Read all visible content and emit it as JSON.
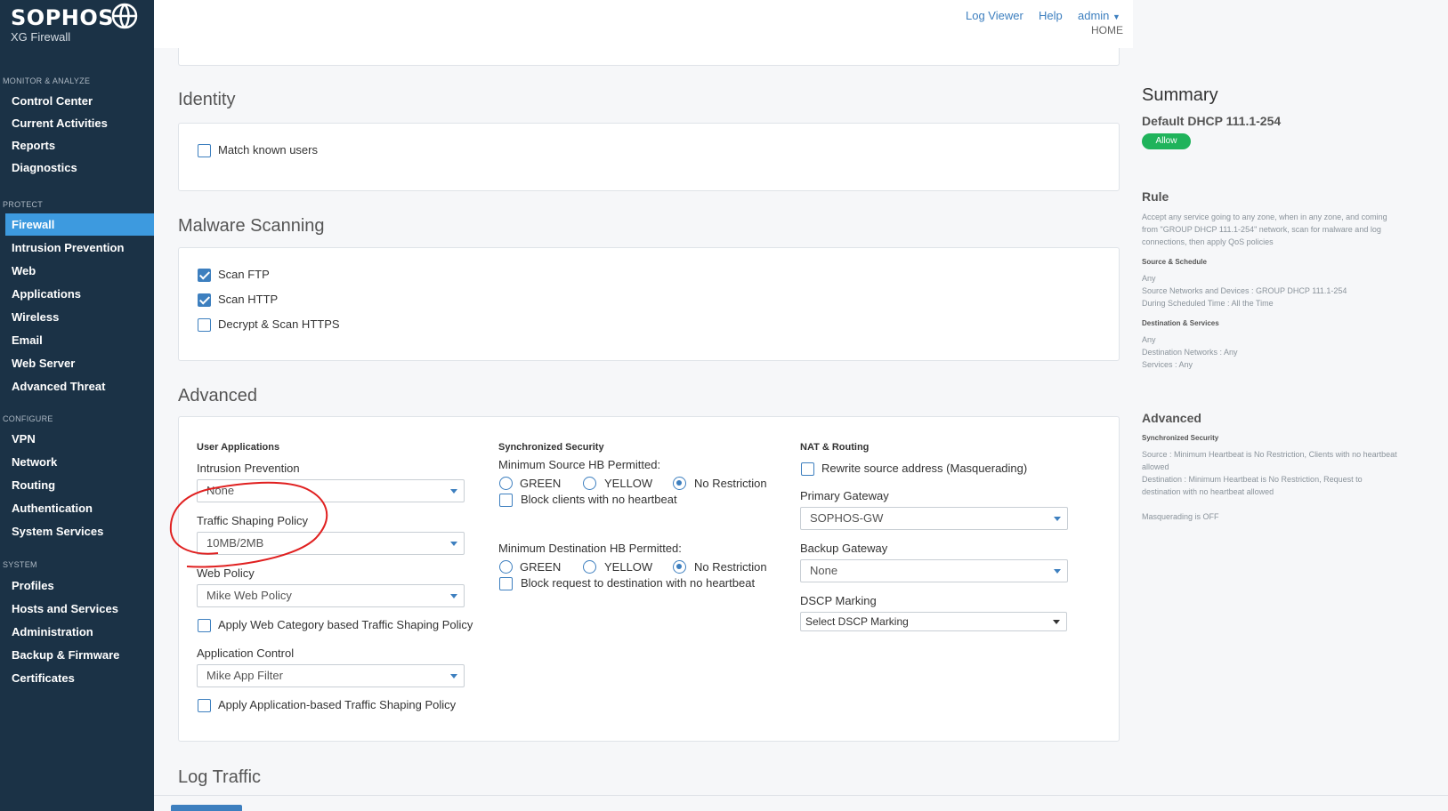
{
  "brand": {
    "name": "SOPHOS",
    "product": "XG Firewall"
  },
  "sidebar": {
    "sections": [
      {
        "title": "MONITOR & ANALYZE",
        "items": [
          "Control Center",
          "Current Activities",
          "Reports",
          "Diagnostics"
        ]
      },
      {
        "title": "PROTECT",
        "items": [
          "Firewall",
          "Intrusion Prevention",
          "Web",
          "Applications",
          "Wireless",
          "Email",
          "Web Server",
          "Advanced Threat"
        ]
      },
      {
        "title": "CONFIGURE",
        "items": [
          "VPN",
          "Network",
          "Routing",
          "Authentication",
          "System Services"
        ]
      },
      {
        "title": "SYSTEM",
        "items": [
          "Profiles",
          "Hosts and Services",
          "Administration",
          "Backup & Firmware",
          "Certificates"
        ]
      }
    ],
    "active": "Firewall"
  },
  "topbar": {
    "log_viewer": "Log Viewer",
    "help": "Help",
    "admin": "admin",
    "home": "HOME"
  },
  "identity": {
    "title": "Identity",
    "match_known_users": "Match known users"
  },
  "malware": {
    "title": "Malware Scanning",
    "scan_ftp": "Scan FTP",
    "scan_http": "Scan HTTP",
    "decrypt_https": "Decrypt & Scan HTTPS"
  },
  "advanced": {
    "title": "Advanced",
    "user_apps": {
      "heading": "User Applications",
      "ips_label": "Intrusion Prevention",
      "ips_value": "None",
      "tsp_label": "Traffic Shaping Policy",
      "tsp_value": "10MB/2MB",
      "web_label": "Web Policy",
      "web_value": "Mike Web Policy",
      "web_shaping": "Apply Web Category based Traffic Shaping Policy",
      "app_label": "Application Control",
      "app_value": "Mike App Filter",
      "app_shaping": "Apply Application-based Traffic Shaping Policy"
    },
    "sync": {
      "heading": "Synchronized Security",
      "src_label": "Minimum Source HB Permitted:",
      "dst_label": "Minimum Destination HB Permitted:",
      "green": "GREEN",
      "yellow": "YELLOW",
      "no_restriction": "No Restriction",
      "block_clients": "Block clients with no heartbeat",
      "block_dest": "Block request to destination with no heartbeat"
    },
    "nat": {
      "heading": "NAT & Routing",
      "masq": "Rewrite source address (Masquerading)",
      "primary_label": "Primary Gateway",
      "primary_value": "SOPHOS-GW",
      "backup_label": "Backup Gateway",
      "backup_value": "None",
      "dscp_label": "DSCP Marking",
      "dscp_value": "Select DSCP Marking"
    }
  },
  "log_traffic": {
    "title": "Log Traffic"
  },
  "summary": {
    "title": "Summary",
    "rule_name": "Default DHCP 111.1-254",
    "status": "Allow",
    "rule_heading": "Rule",
    "rule_desc": "Accept any service going to any zone, when in any zone, and coming from \"GROUP DHCP 111.1-254\" network, scan for malware and log connections, then apply QoS policies",
    "src_heading": "Source & Schedule",
    "src_any": "Any",
    "src_networks": "Source Networks and Devices : GROUP DHCP 111.1-254",
    "src_schedule": "During Scheduled Time : All the Time",
    "dst_heading": "Destination & Services",
    "dst_any": "Any",
    "dst_networks": "Destination Networks : Any",
    "dst_services": "Services : Any",
    "adv_heading": "Advanced",
    "adv_sync": "Synchronized Security",
    "adv_source": "Source : Minimum Heartbeat is No Restriction, Clients with no heartbeat allowed",
    "adv_dest": "Destination : Minimum Heartbeat is No Restriction, Request to destination with no heartbeat allowed",
    "adv_masq": "Masquerading is OFF"
  }
}
